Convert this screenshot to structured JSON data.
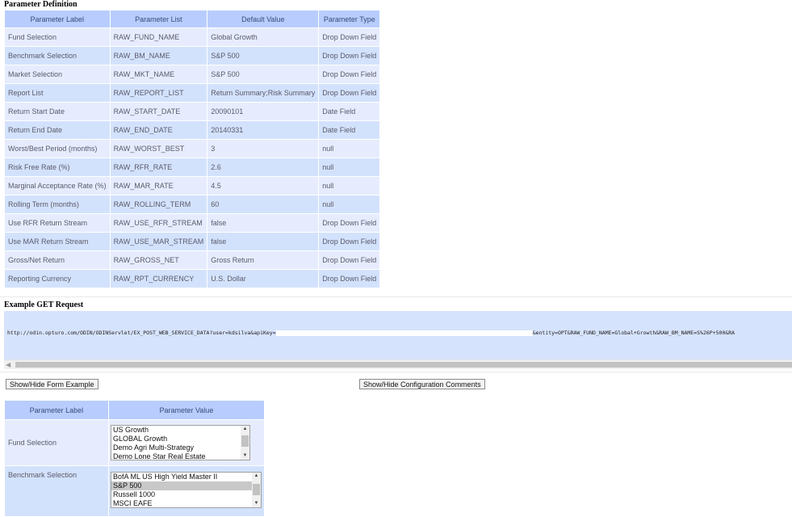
{
  "param_def": {
    "title": "Parameter Definition",
    "headers": [
      "Parameter Label",
      "Parameter List",
      "Default Value",
      "Parameter Type"
    ],
    "rows": [
      {
        "label": "Fund Selection",
        "list": "RAW_FUND_NAME",
        "default": "Global Growth",
        "type": "Drop Down Field"
      },
      {
        "label": "Benchmark Selection",
        "list": "RAW_BM_NAME",
        "default": "S&P 500",
        "type": "Drop Down Field"
      },
      {
        "label": "Market Selection",
        "list": "RAW_MKT_NAME",
        "default": "S&P 500",
        "type": "Drop Down Field"
      },
      {
        "label": "Report List",
        "list": "RAW_REPORT_LIST",
        "default": "Return Summary;Risk Summary",
        "type": "Drop Down Field"
      },
      {
        "label": "Return Start Date",
        "list": "RAW_START_DATE",
        "default": "20090101",
        "type": "Date Field"
      },
      {
        "label": "Return End Date",
        "list": "RAW_END_DATE",
        "default": "20140331",
        "type": "Date Field"
      },
      {
        "label": "Worst/Best Period (months)",
        "list": "RAW_WORST_BEST",
        "default": "3",
        "type": "null"
      },
      {
        "label": "Risk Free Rate (%)",
        "list": "RAW_RFR_RATE",
        "default": "2.6",
        "type": "null"
      },
      {
        "label": "Marginal Acceptance Rate (%)",
        "list": "RAW_MAR_RATE",
        "default": "4.5",
        "type": "null"
      },
      {
        "label": "Rolling Term (months)",
        "list": "RAW_ROLLING_TERM",
        "default": "60",
        "type": "null"
      },
      {
        "label": "Use RFR Return Stream",
        "list": "RAW_USE_RFR_STREAM",
        "default": "false",
        "type": "Drop Down Field"
      },
      {
        "label": "Use MAR Return Stream",
        "list": "RAW_USE_MAR_STREAM",
        "default": "false",
        "type": "Drop Down Field"
      },
      {
        "label": "Gross/Net Return",
        "list": "RAW_GROSS_NET",
        "default": "Gross Return",
        "type": "Drop Down Field"
      },
      {
        "label": "Reporting Currency",
        "list": "RAW_RPT_CURRENCY",
        "default": "U.S. Dollar",
        "type": "Drop Down Field"
      }
    ]
  },
  "request": {
    "title": "Example GET Request",
    "url_prefix": "http://odin.opturo.com/ODIN/ODINServlet/EX_POST_WEB_SERVICE_DATA?user=kdsilva&apiKey=",
    "url_suffix": "&entity=OPT&RAW_FUND_NAME=Global+Growth&RAW_BM_NAME=S%26P+500&RA"
  },
  "buttons": {
    "form_example": "Show/Hide Form Example",
    "config_comments": "Show/Hide Configuration Comments"
  },
  "form": {
    "headers": [
      "Parameter Label",
      "Parameter Value"
    ],
    "fund_label": "Fund Selection",
    "fund_options": [
      "US Growth",
      "GLOBAL Growth",
      "Demo Agri Multi-Strategy",
      "Demo Lone Star Real Estate"
    ],
    "bm_label": "Benchmark Selection",
    "bm_options": [
      "BofA ML US High Yield Master II",
      "S&P 500",
      "Russell 1000",
      "MSCI EAFE"
    ],
    "bm_selected": "S&P 500"
  }
}
